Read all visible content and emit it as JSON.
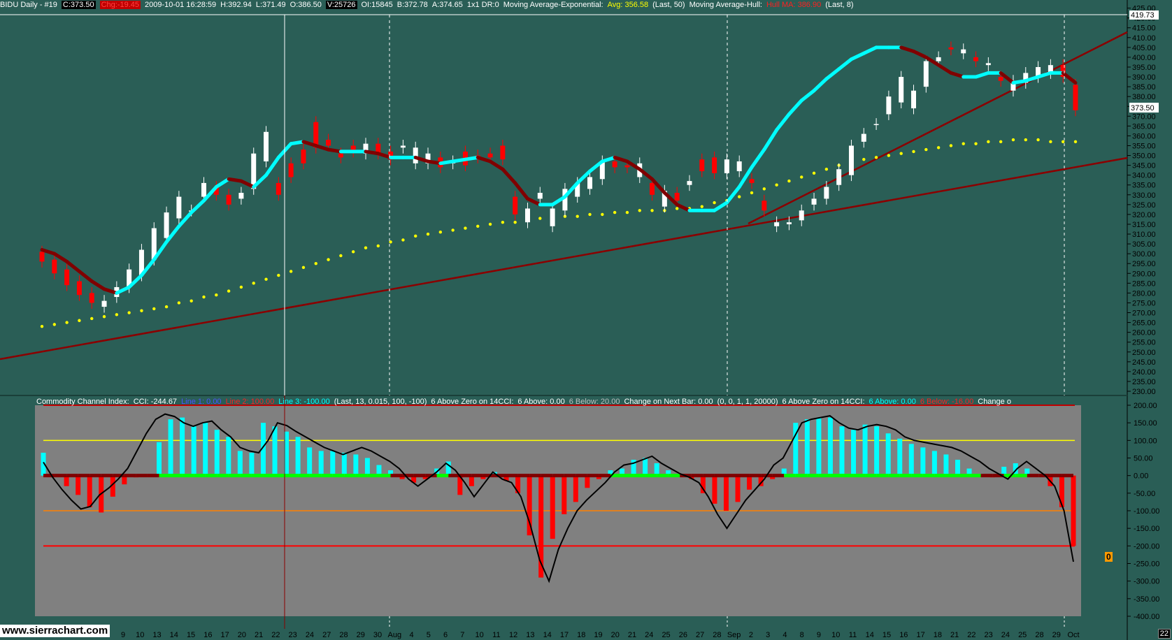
{
  "header": {
    "symbol_info": "BIDU  Daily - #19",
    "close": "C:373.50",
    "change": "Chg:-19.45",
    "datetime": "2009-10-01  16:28:59",
    "high": "H:392.94",
    "low": "L:371.49",
    "open": "O:386.50",
    "volume": "V:25726",
    "oi": "OI:15845",
    "bid": "B:372.78",
    "ask": "A:374.65",
    "misc": "1x1  DR:0",
    "ema_name": "Moving Average-Exponential:",
    "ema_value": "Avg: 356.58",
    "ema_params": "(Last, 50)",
    "hull_name": "Moving Average-Hull:",
    "hull_value": "Hull MA: 386.90",
    "hull_params": "(Last, 8)"
  },
  "cci_header": {
    "name": "Commodity Channel Index:",
    "cci": "CCI: -244.67",
    "line1": "Line 1: 0.00",
    "line2": "Line 2: 100.00",
    "line3": "Line 3: -100.00",
    "params": "(Last, 13, 0.015, 100, -100)",
    "above_title": "6 Above Zero on 14CCI:",
    "above": "6 Above: 0.00",
    "below": "6 Below: 20.00",
    "change_next": "Change on Next Bar: 0.00",
    "change_params": "(0, 0, 1, 1, 20000)",
    "above_title2": "6 Above Zero on 14CCI:",
    "above2": "6 Above: 0.00",
    "below2": "6 Below: -16.00",
    "change_trunc": "Change o"
  },
  "price_labels": {
    "last_price": "373.50",
    "top_price": "419.73"
  },
  "watermark": "www.sierrachart.com",
  "zero_badge": "0",
  "corner_label": "22",
  "colors": {
    "background": "#2a5e56",
    "up_candle": "#ffffff",
    "down_candle": "#ff0000",
    "hull_up": "#00ffff",
    "hull_down": "#800000",
    "ema_dots": "#ffff00",
    "trendline": "#8b0000",
    "cci_bg": "#808080",
    "cci_line": "#000000",
    "cci_up_bar": "#00ffff",
    "cci_down_bar": "#ff0000",
    "level_100": "#ffff00",
    "level_minus100": "#ff8000",
    "level_minus200": "#ff0000",
    "zero_line_pos": "#00ff00",
    "zero_line_neg": "#800000"
  },
  "chart_data": [
    {
      "type": "candlestick",
      "title": "BIDU Daily",
      "y_ticks": [
        "425.00",
        "420.00",
        "415.00",
        "410.00",
        "405.00",
        "400.00",
        "395.00",
        "390.00",
        "385.00",
        "380.00",
        "375.00",
        "370.00",
        "365.00",
        "360.00",
        "355.00",
        "350.00",
        "345.00",
        "340.00",
        "335.00",
        "330.00",
        "325.00",
        "320.00",
        "315.00",
        "310.00",
        "305.00",
        "300.00",
        "295.00",
        "290.00",
        "285.00",
        "280.00",
        "275.00",
        "270.00",
        "265.00",
        "260.00",
        "255.00",
        "250.00",
        "245.00",
        "240.00",
        "235.00",
        "230.00"
      ],
      "ylim": [
        230,
        427
      ],
      "x_labels": [
        "9",
        "10",
        "13",
        "14",
        "15",
        "16",
        "17",
        "20",
        "21",
        "22",
        "23",
        "24",
        "27",
        "28",
        "29",
        "30",
        "Aug",
        "4",
        "5",
        "6",
        "7",
        "10",
        "11",
        "12",
        "13",
        "14",
        "17",
        "18",
        "19",
        "20",
        "21",
        "24",
        "25",
        "26",
        "27",
        "28",
        "Sep",
        "2",
        "3",
        "4",
        "8",
        "9",
        "10",
        "11",
        "14",
        "15",
        "16",
        "17",
        "18",
        "21",
        "22",
        "23",
        "24",
        "25",
        "28",
        "29",
        "Oct"
      ],
      "candles_open": [
        301,
        297,
        292,
        286,
        280,
        273,
        278,
        283,
        289,
        297,
        308,
        318,
        322,
        329,
        334,
        330,
        328,
        333,
        347,
        336,
        346,
        353,
        367,
        358,
        351,
        355,
        351,
        356,
        352,
        354,
        346,
        346,
        349,
        346,
        352,
        350,
        351,
        355,
        329,
        316,
        328,
        314,
        322,
        329,
        333,
        338,
        347,
        345,
        339,
        336,
        324,
        331,
        335,
        348,
        349,
        341,
        342,
        338,
        327,
        314,
        315,
        317,
        325,
        328,
        335,
        340,
        357,
        366,
        371,
        377,
        374,
        385,
        398,
        405,
        402,
        400,
        396,
        390,
        383,
        387,
        390,
        392,
        396,
        386
      ],
      "candles_close": [
        296,
        290,
        284,
        279,
        275,
        276,
        283,
        292,
        302,
        313,
        321,
        329,
        322,
        336,
        330,
        325,
        331,
        351,
        362,
        330,
        339,
        346,
        354,
        355,
        349,
        352,
        356,
        351,
        348,
        355,
        354,
        351,
        344,
        347,
        345,
        349,
        349,
        348,
        320,
        323,
        331,
        323,
        333,
        336,
        339,
        347,
        344,
        344,
        346,
        330,
        332,
        327,
        337,
        342,
        341,
        348,
        347,
        336,
        322,
        316,
        316,
        322,
        328,
        334,
        343,
        355,
        361,
        366,
        380,
        390,
        383,
        398,
        400,
        404,
        404,
        398,
        397,
        388,
        388,
        392,
        395,
        396,
        390,
        373
      ],
      "hull_ma": [
        302,
        300,
        296,
        291,
        286,
        282,
        280,
        283,
        289,
        297,
        306,
        314,
        321,
        327,
        334,
        338,
        337,
        334,
        340,
        349,
        356,
        357,
        355,
        353,
        352,
        352,
        352,
        351,
        349,
        349,
        349,
        347,
        346,
        347,
        348,
        349,
        347,
        343,
        336,
        328,
        325,
        325,
        329,
        336,
        342,
        347,
        349,
        347,
        343,
        338,
        331,
        325,
        322,
        322,
        322,
        326,
        334,
        344,
        353,
        363,
        371,
        378,
        383,
        389,
        394,
        399,
        402,
        405,
        405,
        405,
        403,
        400,
        396,
        392,
        390,
        390,
        392,
        392,
        387,
        388,
        390,
        392,
        392,
        387
      ],
      "ema_50": [
        263,
        264,
        265,
        266,
        267,
        268,
        269,
        270,
        271,
        272,
        273,
        275,
        276,
        278,
        279,
        281,
        283,
        285,
        287,
        289,
        291,
        293,
        295,
        297,
        299,
        301,
        303,
        304,
        306,
        307,
        309,
        310,
        311,
        312,
        313,
        314,
        315,
        316,
        316,
        317,
        318,
        318,
        319,
        319,
        320,
        320,
        321,
        321,
        322,
        322,
        322,
        323,
        323,
        324,
        326,
        327,
        329,
        331,
        333,
        335,
        337,
        339,
        341,
        343,
        345,
        346,
        348,
        349,
        350,
        351,
        352,
        353,
        354,
        355,
        356,
        356,
        357,
        357,
        358,
        358,
        358,
        357,
        357,
        357
      ]
    },
    {
      "type": "bar",
      "title": "Commodity Channel Index",
      "y_ticks": [
        "200.00",
        "150.00",
        "100.00",
        "50.00",
        "0.00",
        "-50.00",
        "-100.00",
        "-150.00",
        "-200.00",
        "-250.00",
        "-300.00",
        "-350.00",
        "-400.00"
      ],
      "ylim": [
        -400,
        200
      ],
      "levels": [
        100,
        -100,
        -200
      ],
      "cci_line": [
        38,
        -5,
        -40,
        -70,
        -95,
        -88,
        -55,
        -35,
        -10,
        20,
        70,
        120,
        160,
        175,
        168,
        150,
        140,
        150,
        155,
        130,
        110,
        80,
        70,
        65,
        100,
        150,
        142,
        125,
        110,
        95,
        80,
        70,
        60,
        70,
        80,
        70,
        55,
        40,
        20,
        -10,
        -30,
        -10,
        10,
        35,
        15,
        -20,
        -60,
        -25,
        10,
        -10,
        -20,
        -60,
        -140,
        -240,
        -300,
        -210,
        -150,
        -100,
        -70,
        -45,
        -20,
        10,
        30,
        35,
        45,
        55,
        35,
        20,
        5,
        -5,
        -20,
        -60,
        -110,
        -150,
        -110,
        -70,
        -40,
        -10,
        30,
        50,
        100,
        150,
        160,
        165,
        170,
        150,
        135,
        130,
        140,
        145,
        140,
        130,
        110,
        100,
        95,
        90,
        85,
        80,
        70,
        55,
        40,
        20,
        5,
        -10,
        20,
        40,
        20,
        0,
        -30,
        -100,
        -245
      ],
      "cci_bars": [
        65,
        0,
        -30,
        -55,
        -90,
        -105,
        -60,
        -25,
        -5,
        0,
        95,
        160,
        165,
        140,
        150,
        130,
        110,
        70,
        65,
        150,
        140,
        125,
        110,
        80,
        70,
        70,
        65,
        60,
        50,
        30,
        15,
        -10,
        -20,
        -10,
        20,
        40,
        -55,
        -30,
        -10,
        10,
        -15,
        -50,
        -170,
        -290,
        -180,
        -110,
        -75,
        -35,
        -10,
        15,
        20,
        45,
        50,
        35,
        15,
        5,
        -10,
        -50,
        -80,
        -100,
        -75,
        -40,
        -30,
        -10,
        20,
        150,
        160,
        165,
        165,
        140,
        130,
        145,
        140,
        120,
        105,
        90,
        80,
        70,
        60,
        45,
        20,
        5,
        -5,
        25,
        35,
        20,
        0,
        -30,
        -90,
        -200
      ]
    }
  ]
}
